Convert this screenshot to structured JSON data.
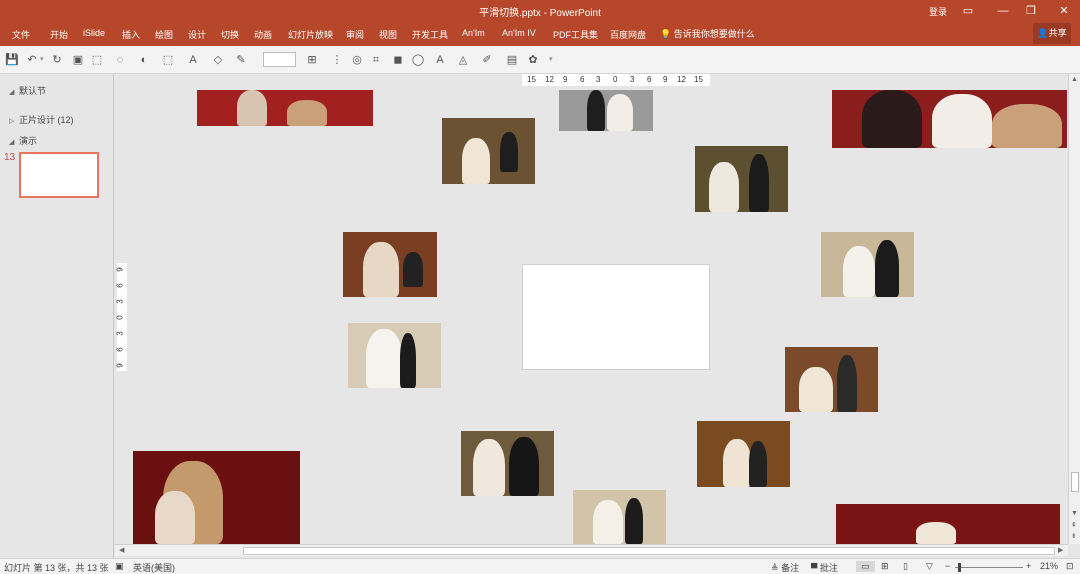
{
  "window": {
    "title": "平滑切换.pptx - PowerPoint",
    "login": "登录",
    "ribbon_display_icon": "ribbon-display-icon",
    "minimize_icon": "minimize-icon",
    "restore_icon": "restore-icon",
    "close_icon": "close-icon"
  },
  "menu": {
    "tabs": [
      "文件",
      "开始",
      "iSlide",
      "插入",
      "绘图",
      "设计",
      "切换",
      "动画",
      "幻灯片放映",
      "审阅",
      "视图",
      "开发工具",
      "An'Im",
      "An'Im IV",
      "PDF工具集",
      "百度网盘"
    ],
    "tell_me": "告诉我你想要做什么",
    "share": "共享"
  },
  "toolbar": {
    "icons": [
      "save-icon",
      "undo-icon",
      "redo-icon",
      "start-from-beginning-icon",
      "format-painter-icon",
      "shape-icon",
      "shape-fill-icon",
      "select-icon",
      "font-color-icon",
      "fill-color-icon",
      "outline-icon",
      "font-size-box",
      "align-icon",
      "distribute-icon",
      "group-icon",
      "crop-icon",
      "arrange-icon",
      "text-effect-icon",
      "shape-effect-icon",
      "shape-outline-icon",
      "pen-icon",
      "more-icon"
    ],
    "font_size": ""
  },
  "left_pane": {
    "sections": [
      {
        "label": "默认节",
        "expanded": true
      },
      {
        "label": "正片设计 (12)",
        "expanded": false
      },
      {
        "label": "演示",
        "expanded": true
      }
    ],
    "slide_number": "13"
  },
  "ruler": {
    "horizontal": [
      "15",
      "12",
      "9",
      "6",
      "3",
      "0",
      "3",
      "6",
      "9",
      "12",
      "15"
    ],
    "vertical": [
      "9",
      "6",
      "3",
      "0",
      "3",
      "6",
      "9"
    ]
  },
  "canvas": {
    "photos": [
      {
        "name": "photo-wedding-red-sign-top-left",
        "bg": "#a32020"
      },
      {
        "name": "photo-couple-sofa",
        "bg": "#6b5232"
      },
      {
        "name": "photo-couple-gray-wall",
        "bg": "#9a9a9a"
      },
      {
        "name": "photo-couple-landscape-painting",
        "bg": "#5c5030"
      },
      {
        "name": "photo-wedding-red-sign-top-right",
        "bg": "#8c1d1d"
      },
      {
        "name": "photo-couple-piano-dance",
        "bg": "#7a3e22"
      },
      {
        "name": "photo-couple-beige-backdrop",
        "bg": "#c9b79a"
      },
      {
        "name": "photo-couple-veil",
        "bg": "#d8cbb6"
      },
      {
        "name": "photo-couple-piano-room",
        "bg": "#7b4a2a"
      },
      {
        "name": "photo-couple-ring",
        "bg": "#6e5a3c"
      },
      {
        "name": "photo-couple-chandelier",
        "bg": "#7a4a20"
      },
      {
        "name": "photo-wedding-red-sign-bottom-left",
        "bg": "#6a1010"
      },
      {
        "name": "photo-couple-standing-beige",
        "bg": "#d2c4a8"
      },
      {
        "name": "photo-wedding-red-curtain-bottom-right",
        "bg": "#7a1414"
      }
    ]
  },
  "status": {
    "slide_info": "幻灯片 第 13 张，共 13 张",
    "language": "英语(美国)",
    "notes": "备注",
    "comments": "批注",
    "zoom": "21%"
  }
}
